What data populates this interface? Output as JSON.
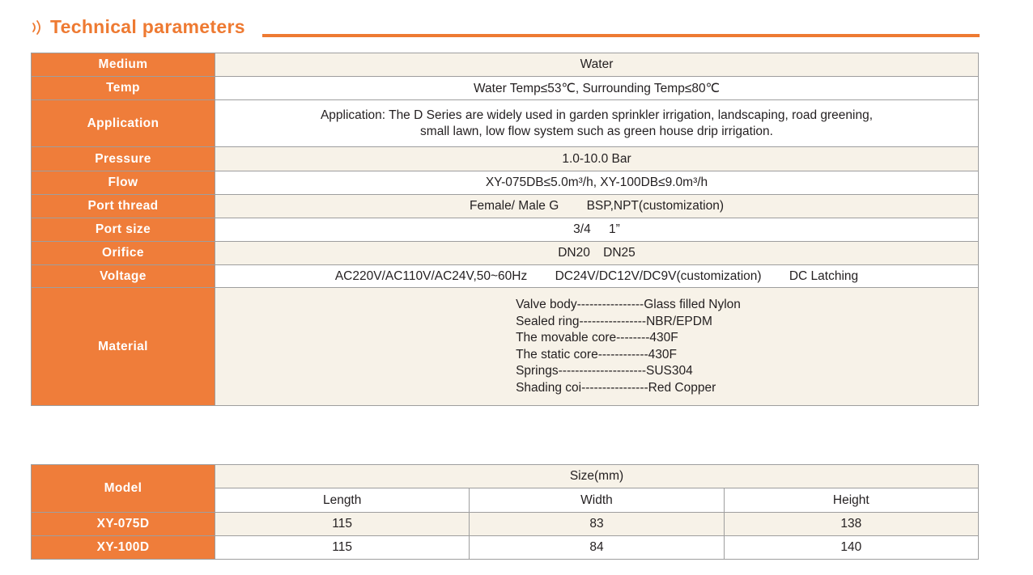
{
  "heading": {
    "title": "Technical parameters"
  },
  "params": {
    "medium": {
      "label": "Medium",
      "value": "Water"
    },
    "temp": {
      "label": "Temp",
      "value": "Water Temp≤53℃, Surrounding Temp≤80℃"
    },
    "application": {
      "label": "Application",
      "line1": "Application:  The D Series are widely used in garden sprinkler  irrigation, landscaping, road greening,",
      "line2": "small lawn, low  flow system such as green house drip irrigation."
    },
    "pressure": {
      "label": "Pressure",
      "value": "1.0-10.0 Bar"
    },
    "flow": {
      "label": "Flow",
      "value": "XY-075DB≤5.0m³/h,  XY-100DB≤9.0m³/h"
    },
    "port_thread": {
      "label": "Port thread",
      "value1": "Female/ Male G",
      "value2": "BSP,NPT(customization)"
    },
    "port_size": {
      "label": "Port size",
      "value1": "3/4",
      "value2": "1”"
    },
    "orifice": {
      "label": "Orifice",
      "value1": "DN20",
      "value2": "DN25"
    },
    "voltage": {
      "label": "Voltage",
      "value1": "AC220V/AC110V/AC24V,50~60Hz",
      "value2": "DC24V/DC12V/DC9V(customization)",
      "value3": "DC Latching"
    },
    "material": {
      "label": "Material",
      "lines": [
        "Valve body----------------Glass filled Nylon",
        "Sealed ring----------------NBR/EPDM",
        "The movable core--------430F",
        "The static core------------430F",
        "Springs---------------------SUS304",
        "Shading coi----------------Red Copper"
      ]
    }
  },
  "sizes": {
    "model_label": "Model",
    "size_header": "Size(mm)",
    "columns": [
      "Length",
      "Width",
      "Height"
    ],
    "rows": [
      {
        "model": "XY-075D",
        "values": [
          "115",
          "83",
          "138"
        ]
      },
      {
        "model": "XY-100D",
        "values": [
          "115",
          "84",
          "140"
        ]
      }
    ]
  },
  "colors": {
    "accent": "#ef7d3a",
    "title": "#ee7a32",
    "row_tint": "#f7f2e8",
    "border": "#9e9e9e"
  },
  "icons": {
    "heading_mark": "sound-waves-icon"
  }
}
